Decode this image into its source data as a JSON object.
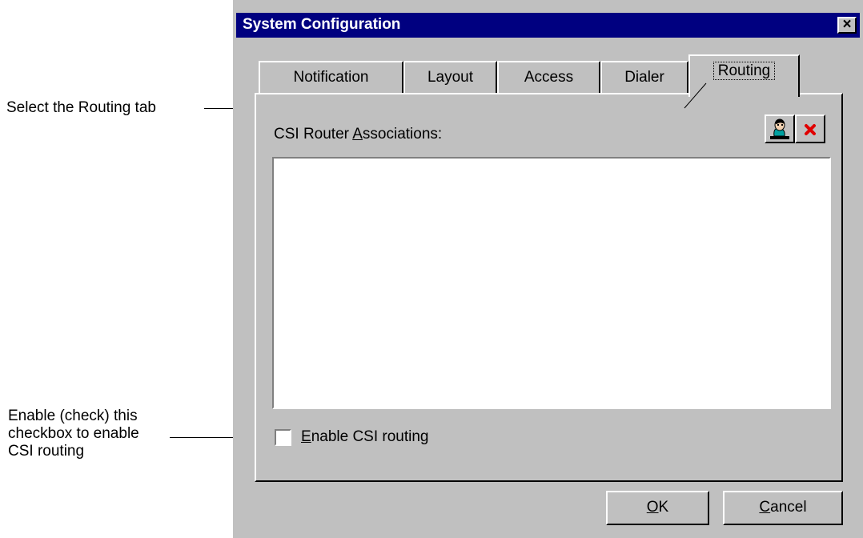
{
  "callouts": {
    "routing_tab": "Select the Routing tab",
    "checkbox_line1": "Enable (check) this",
    "checkbox_line2": "checkbox to enable",
    "checkbox_line3": "CSI routing"
  },
  "window": {
    "title": "System Configuration",
    "close_glyph": "×"
  },
  "tabs": [
    {
      "label": "Notification",
      "active": false
    },
    {
      "label": "Layout",
      "active": false
    },
    {
      "label": "Access",
      "active": false
    },
    {
      "label": "Dialer",
      "active": false
    },
    {
      "label": "Routing",
      "active": true
    }
  ],
  "routing_panel": {
    "associations_label_pre": "CSI Router ",
    "associations_label_mnemonic": "A",
    "associations_label_post": "ssociations:",
    "add_icon": "person-icon",
    "delete_icon": "red-x-icon",
    "associations_items": [],
    "checkbox": {
      "label_mnemonic": "E",
      "label_rest": "nable CSI routing",
      "checked": false
    }
  },
  "buttons": {
    "ok_mnemonic": "O",
    "ok_rest": "K",
    "cancel_mnemonic": "C",
    "cancel_rest": "ancel"
  },
  "colors": {
    "titlebar": "#000080",
    "face": "#c0c0c0",
    "delete_x": "#e00000"
  }
}
